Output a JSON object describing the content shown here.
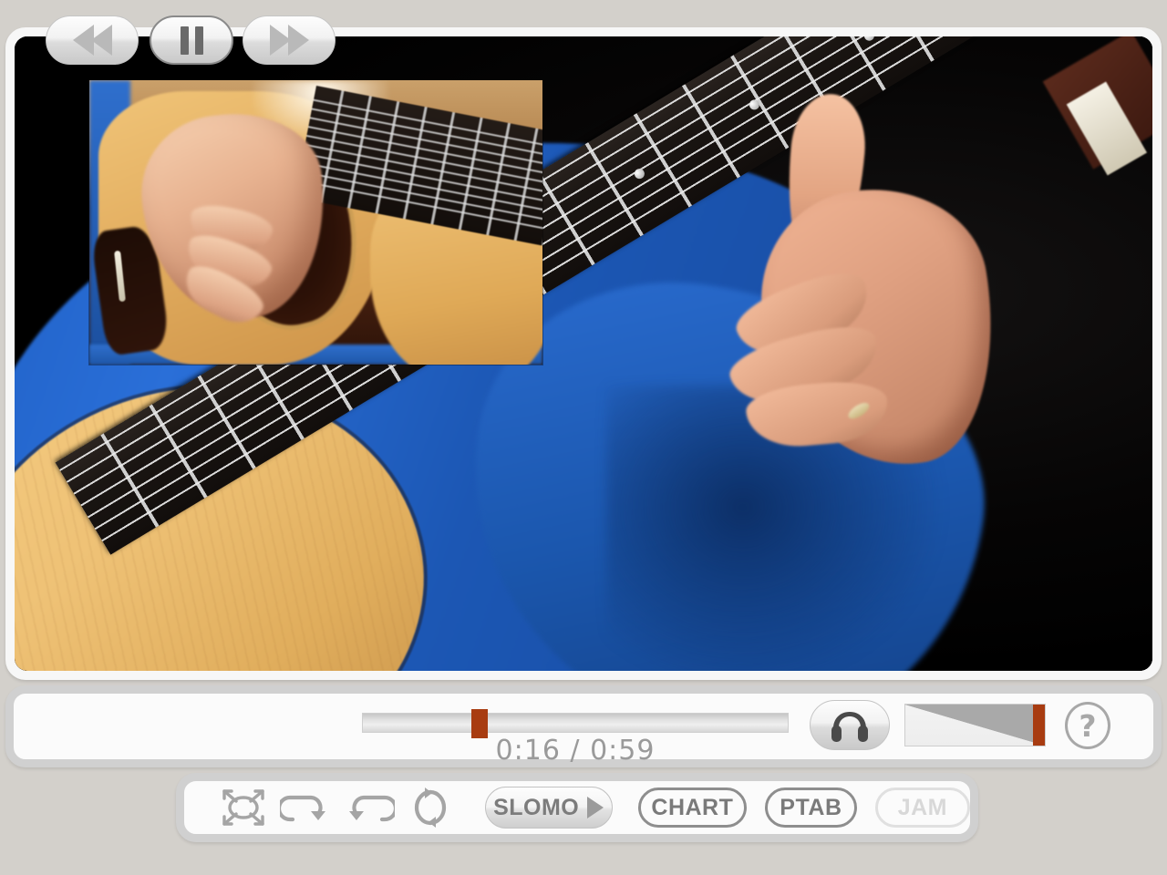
{
  "player": {
    "transport": {
      "rewind_label": "rewind",
      "pause_label": "pause",
      "fast_forward_label": "fast-forward"
    },
    "scrubber": {
      "position_percent": 27,
      "current_time": "0:16",
      "total_time": "0:59",
      "time_display": "0:16 / 0:59"
    },
    "audio": {
      "headphones_label": "headphones",
      "volume_percent": 92
    },
    "help_label": "?"
  },
  "toolbar": {
    "icons": [
      {
        "name": "fullscreen-icon",
        "label": "fullscreen"
      },
      {
        "name": "loop-forward-icon",
        "label": "loop forward"
      },
      {
        "name": "loop-back-icon",
        "label": "loop back"
      },
      {
        "name": "loop-repeat-icon",
        "label": "loop repeat"
      }
    ],
    "slomo": {
      "label": "SLOMO"
    },
    "tags": [
      {
        "label": "CHART",
        "enabled": true
      },
      {
        "label": "PTAB",
        "enabled": true
      },
      {
        "label": "JAM",
        "enabled": false
      }
    ]
  },
  "colors": {
    "accent": "#a83c11",
    "page_background": "#d3d0cb",
    "panel_background": "#fbfbfb",
    "panel_border": "#d0d0d0",
    "text_muted": "#9a9a9a"
  }
}
